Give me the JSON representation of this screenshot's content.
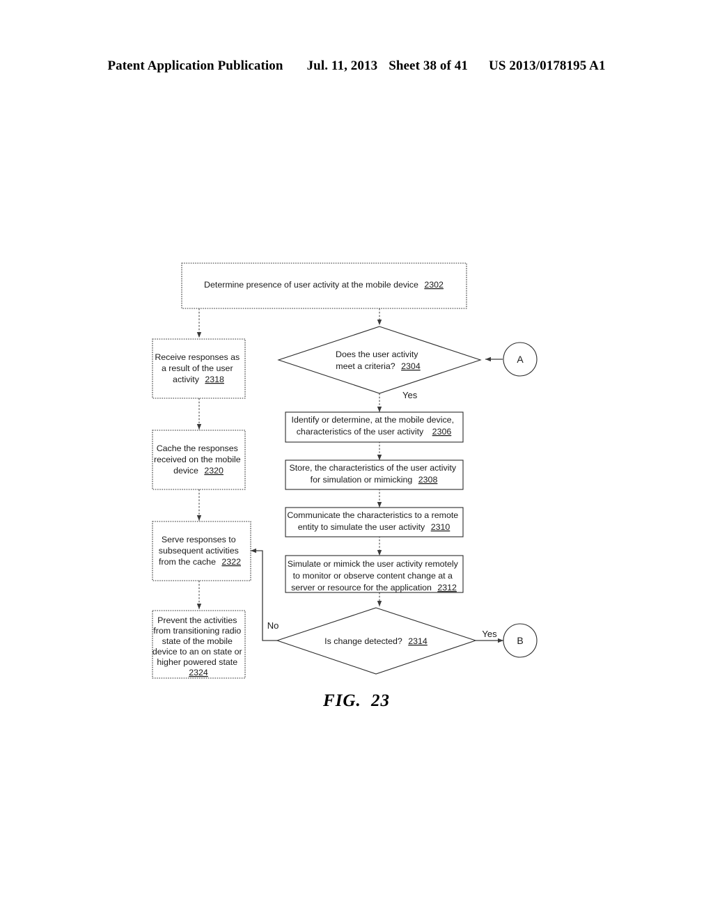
{
  "header": {
    "publication": "Patent Application Publication",
    "date": "Jul. 11, 2013",
    "sheet": "Sheet 38 of 41",
    "patent_number": "US 2013/0178195 A1"
  },
  "figure": {
    "label": "FIG.",
    "number": "23"
  },
  "flowchart": {
    "nodes": {
      "n2302": {
        "ref": "2302",
        "lines": [
          "Determine presence of user activity at the mobile device"
        ],
        "shape": "box",
        "border": "dashed"
      },
      "n2318": {
        "ref": "2318",
        "lines": [
          "Receive responses as",
          "a result of the user",
          "activity"
        ],
        "shape": "box",
        "border": "dashed"
      },
      "n2304": {
        "ref": "2304",
        "lines": [
          "Does the user activity",
          "meet a criteria?"
        ],
        "shape": "diamond",
        "border": "solid"
      },
      "n2306": {
        "ref": "2306",
        "lines": [
          "Identify or determine, at the mobile device,",
          "characteristics of the user activity"
        ],
        "shape": "box",
        "border": "solid"
      },
      "n2320": {
        "ref": "2320",
        "lines": [
          "Cache the responses",
          "received on the mobile",
          "device"
        ],
        "shape": "box",
        "border": "dashed"
      },
      "n2308": {
        "ref": "2308",
        "lines": [
          "Store, the characteristics of the user activity",
          "for simulation or mimicking"
        ],
        "shape": "box",
        "border": "solid"
      },
      "n2310": {
        "ref": "2310",
        "lines": [
          "Communicate the characteristics to a remote",
          "entity to simulate the user activity"
        ],
        "shape": "box",
        "border": "solid"
      },
      "n2322": {
        "ref": "2322",
        "lines": [
          "Serve responses to",
          "subsequent activities",
          "from the cache"
        ],
        "shape": "box",
        "border": "dashed"
      },
      "n2312": {
        "ref": "2312",
        "lines": [
          "Simulate or mimick the user activity remotely",
          "to monitor or observe content change at a",
          "server or resource for the application"
        ],
        "shape": "box",
        "border": "solid"
      },
      "n2324": {
        "ref": "2324",
        "lines": [
          "Prevent the activities",
          "from transitioning radio",
          "state of the mobile",
          "device to an on state or",
          "higher powered state"
        ],
        "shape": "box",
        "border": "dashed"
      },
      "n2314": {
        "ref": "2314",
        "lines": [
          "Is change detected?"
        ],
        "shape": "diamond",
        "border": "solid"
      }
    },
    "connectors": {
      "a": "A",
      "b": "B"
    },
    "edge_labels": {
      "yes_2304": "Yes",
      "no_2314": "No",
      "yes_2314": "Yes"
    }
  }
}
